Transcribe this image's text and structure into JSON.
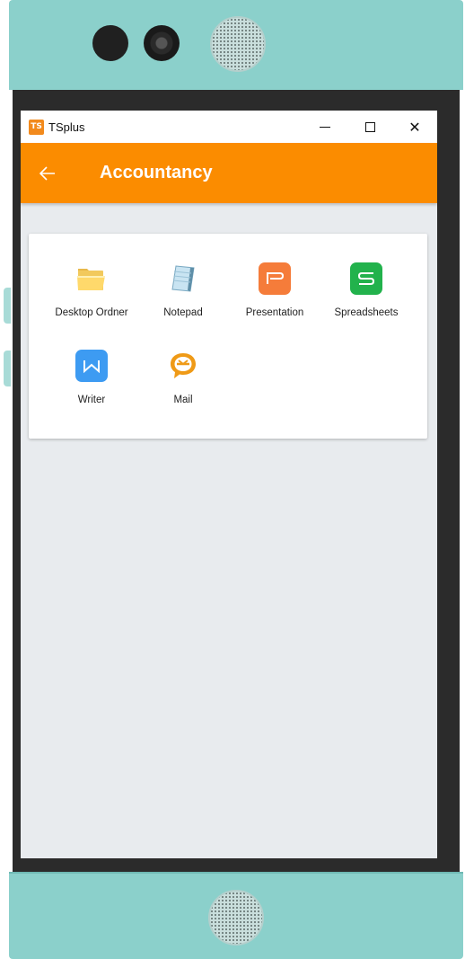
{
  "window": {
    "app_icon_text": "TS",
    "app_title": "TSplus",
    "minimize": "",
    "maximize": "",
    "close": "✕"
  },
  "appbar": {
    "title": "Accountancy"
  },
  "apps": [
    {
      "label": "Desktop Ordner",
      "icon": "folder-icon"
    },
    {
      "label": "Notepad",
      "icon": "notepad-icon"
    },
    {
      "label": "Presentation",
      "icon": "presentation-icon"
    },
    {
      "label": "Spreadsheets",
      "icon": "spreadsheets-icon"
    },
    {
      "label": "Writer",
      "icon": "writer-icon"
    },
    {
      "label": "Mail",
      "icon": "mail-icon"
    }
  ],
  "colors": {
    "appbar": "#fb8c00",
    "presentation": "#f57c3a",
    "spreadsheets": "#22b24c",
    "writer": "#3d9bf2",
    "mail": "#ef9a16",
    "bezel": "#8bd0cb"
  }
}
